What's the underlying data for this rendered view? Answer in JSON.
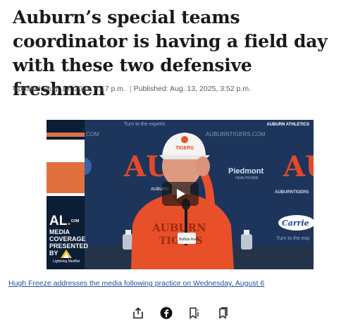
{
  "article": {
    "headline": "Auburn’s special teams coordinator is having a field day with these two defensive freshmen",
    "updated": "Updated: Aug. 13, 2025, 4:17 p.m.",
    "published": "Published: Aug. 13, 2025, 3:52 p.m.",
    "separator": "|"
  },
  "video": {
    "credit": "AUBURN ATHLETICS",
    "turn_to_experts": "Turn to the experts",
    "turn_to_experts_2": "Turn to the exp",
    "backdrop_url": "AUBURNTIGERS.COM",
    "backdrop_url_fragment": "COM",
    "brand_al": "AL",
    "brand_com": "COM",
    "brand_line1": "MEDIA COVERAGE",
    "brand_line2": "PRESENTED BY",
    "sponsor_name": "Lightning Medflat",
    "backdrop_sponsor": "Piedmont",
    "backdrop_sponsor_sub": "HEALTHCARE",
    "backdrop_carrier": "Carrie",
    "backdrop_auburn": "AUBURN",
    "backdrop_auburn_right": "AUBURNTIGERS",
    "hat_text": "TIGERS",
    "shirt_text_1": "AUBURN",
    "shirt_text_2": "TIGERS",
    "bottle_label": "Buffalo Rock"
  },
  "caption": "Hugh Freeze addresses the media following practice on Wednesday, August 6",
  "share": {
    "share_icon": "share-icon",
    "facebook_icon": "facebook-icon",
    "gift_icon": "gift-article-icon",
    "bookmark_icon": "bookmark-icon"
  },
  "colors": {
    "caption_link": "#1f4fa8",
    "auburn_orange": "#e8502a",
    "auburn_navy": "#0c1d36"
  }
}
